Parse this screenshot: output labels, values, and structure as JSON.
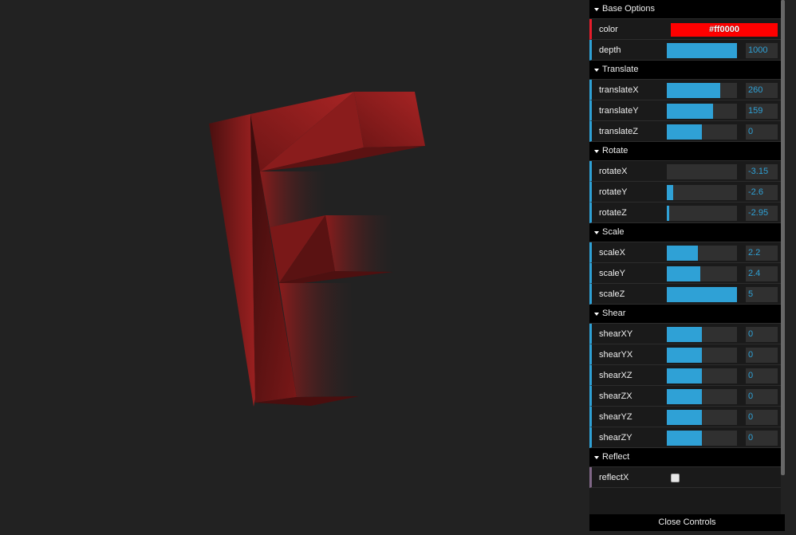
{
  "accent_color": "#2fa1d6",
  "base_options": {
    "title": "Base Options",
    "color_label": "color",
    "color_value": "#ff0000",
    "depth": {
      "label": "depth",
      "value": "1000",
      "fill": 1.0
    }
  },
  "translate": {
    "title": "Translate",
    "items": [
      {
        "label": "translateX",
        "value": "260",
        "fill": 0.76
      },
      {
        "label": "translateY",
        "value": "159",
        "fill": 0.66
      },
      {
        "label": "translateZ",
        "value": "0",
        "fill": 0.5
      }
    ]
  },
  "rotate": {
    "title": "Rotate",
    "items": [
      {
        "label": "rotateX",
        "value": "-3.15",
        "fill": 0.0
      },
      {
        "label": "rotateY",
        "value": "-2.6",
        "fill": 0.09
      },
      {
        "label": "rotateZ",
        "value": "-2.95",
        "fill": 0.03
      }
    ]
  },
  "scale": {
    "title": "Scale",
    "items": [
      {
        "label": "scaleX",
        "value": "2.2",
        "fill": 0.44
      },
      {
        "label": "scaleY",
        "value": "2.4",
        "fill": 0.48
      },
      {
        "label": "scaleZ",
        "value": "5",
        "fill": 1.0
      }
    ]
  },
  "shear": {
    "title": "Shear",
    "items": [
      {
        "label": "shearXY",
        "value": "0",
        "fill": 0.5
      },
      {
        "label": "shearYX",
        "value": "0",
        "fill": 0.5
      },
      {
        "label": "shearXZ",
        "value": "0",
        "fill": 0.5
      },
      {
        "label": "shearZX",
        "value": "0",
        "fill": 0.5
      },
      {
        "label": "shearYZ",
        "value": "0",
        "fill": 0.5
      },
      {
        "label": "shearZY",
        "value": "0",
        "fill": 0.5
      }
    ]
  },
  "reflect": {
    "title": "Reflect",
    "items": [
      {
        "label": "reflectX",
        "checked": false
      }
    ]
  },
  "close_controls": "Close Controls"
}
